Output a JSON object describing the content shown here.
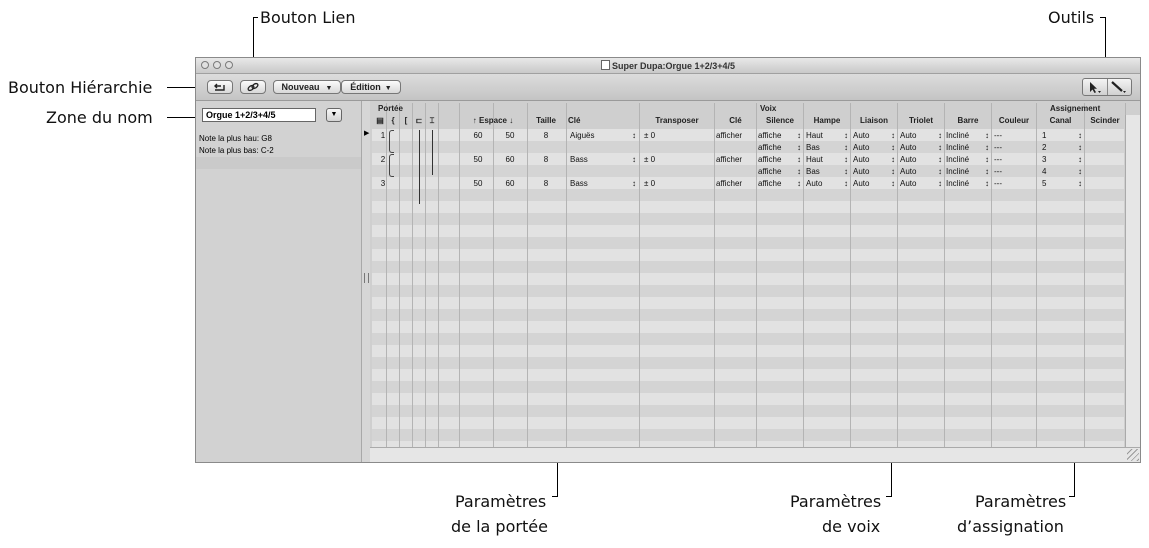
{
  "callouts": {
    "bouton_lien": "Bouton Lien",
    "outils": "Outils",
    "bouton_hierarchie": "Bouton Hiérarchie",
    "zone_du_nom": "Zone du nom",
    "params_portee_l1": "Paramètres",
    "params_portee_l2": "de la portée",
    "params_voix_l1": "Paramètres",
    "params_voix_l2": "de voix",
    "params_assign_l1": "Paramètres",
    "params_assign_l2": "d’assignation"
  },
  "window": {
    "title": "Super Dupa:Orgue 1+2/3+4/5"
  },
  "toolbar": {
    "hierarchy_icon": "arrow-up-left-icon",
    "link_icon": "link-icon",
    "nouveau_label": "Nouveau",
    "edition_label": "Édition",
    "pointer_tool_icon": "pointer-arrow-icon",
    "pencil_tool_icon": "pencil-icon"
  },
  "left": {
    "name_value": "Orgue 1+2/3+4/5",
    "highest_note": "Note la plus hau: G8",
    "lowest_note": "Note la plus bas: C-2"
  },
  "groups": {
    "portee": "Portée",
    "voix": "Voix",
    "assignement": "Assignement"
  },
  "headers": {
    "espace": "Espace",
    "taille": "Taille",
    "cle": "Clé",
    "transposer": "Transposer",
    "cle2": "Clé",
    "silence": "Silence",
    "hampe": "Hampe",
    "liaison": "Liaison",
    "triolet": "Triolet",
    "barre": "Barre",
    "couleur": "Couleur",
    "canal": "Canal",
    "scinder": "Scinder"
  },
  "rows": [
    {
      "num": "1",
      "esp1": "60",
      "esp2": "50",
      "taille": "8",
      "cle": "Aiguës",
      "transposer": "± 0",
      "cle2": "afficher",
      "silence": "affiche",
      "hampe": "Haut",
      "liaison": "Auto",
      "triolet": "Auto",
      "barre": "Incliné",
      "couleur": "---",
      "canal": "1"
    },
    {
      "num": "",
      "esp1": "",
      "esp2": "",
      "taille": "",
      "cle": "",
      "transposer": "",
      "cle2": "",
      "silence": "affiche",
      "hampe": "Bas",
      "liaison": "Auto",
      "triolet": "Auto",
      "barre": "Incliné",
      "couleur": "---",
      "canal": "2"
    },
    {
      "num": "2",
      "esp1": "50",
      "esp2": "60",
      "taille": "8",
      "cle": "Bass",
      "transposer": "± 0",
      "cle2": "afficher",
      "silence": "affiche",
      "hampe": "Haut",
      "liaison": "Auto",
      "triolet": "Auto",
      "barre": "Incliné",
      "couleur": "---",
      "canal": "3"
    },
    {
      "num": "",
      "esp1": "",
      "esp2": "",
      "taille": "",
      "cle": "",
      "transposer": "",
      "cle2": "",
      "silence": "affiche",
      "hampe": "Bas",
      "liaison": "Auto",
      "triolet": "Auto",
      "barre": "Incliné",
      "couleur": "---",
      "canal": "4"
    },
    {
      "num": "3",
      "esp1": "50",
      "esp2": "60",
      "taille": "8",
      "cle": "Bass",
      "transposer": "± 0",
      "cle2": "afficher",
      "silence": "affiche",
      "hampe": "Auto",
      "liaison": "Auto",
      "triolet": "Auto",
      "barre": "Incliné",
      "couleur": "---",
      "canal": "5"
    }
  ],
  "stepper_glyph": "↕",
  "colors": {
    "row_light": "#e2e2e2",
    "row_dark": "#d4d4d4",
    "window_bg": "#d6d6d6"
  }
}
